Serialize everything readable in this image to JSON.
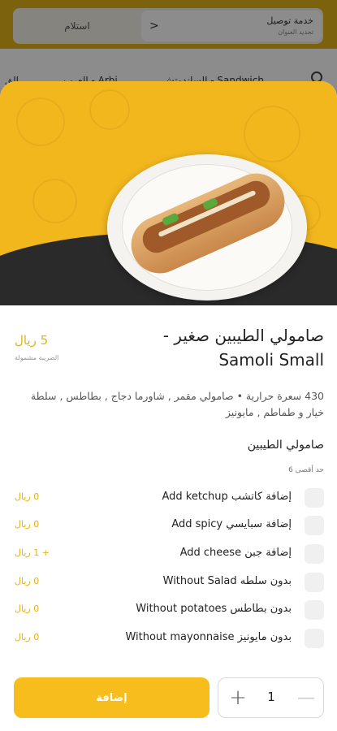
{
  "background": {
    "header": {
      "receive_label": "استلام",
      "delivery_title": "خدمة توصيل",
      "delivery_subtitle": "تحديد العنوان",
      "chevron": "<"
    },
    "categories": [
      "الق",
      "العرب - Arbi",
      "الساندوتش - Sandwich"
    ]
  },
  "product": {
    "title_ar": "صامولي الطيبين صغير -",
    "title_en": "Samoli Small",
    "price": "5 ريال",
    "vat_note": "الضريبة مشمولة",
    "description": "430 سعرة حرارية • صامولي مقمر , شاورما دجاج , بطاطس , سلطة خيار و طماطم , مايونيز",
    "image_icon": "sandwich-image"
  },
  "options_group": {
    "title": "صامولي الطيبين",
    "limit": "حد أقصى 6",
    "options": [
      {
        "label": "إضافة كاتشب Add ketchup",
        "price": "0 ريال"
      },
      {
        "label": "إضافة سبايسي Add spicy",
        "price": "0 ريال"
      },
      {
        "label": "إضافة جبن Add cheese",
        "price": "+ 1 ريال"
      },
      {
        "label": "بدون سلطه Without Salad",
        "price": "0 ريال"
      },
      {
        "label": "بدون بطاطس Without potatoes",
        "price": "0 ريال"
      },
      {
        "label": "بدون مايونيز Without mayonnaise",
        "price": "0 ريال"
      }
    ]
  },
  "footer": {
    "add_label": "إضافة",
    "quantity": "1",
    "plus_icon": "+",
    "minus_icon": "—"
  },
  "colors": {
    "accent": "#f7bd1c",
    "price": "#e3b21a"
  }
}
